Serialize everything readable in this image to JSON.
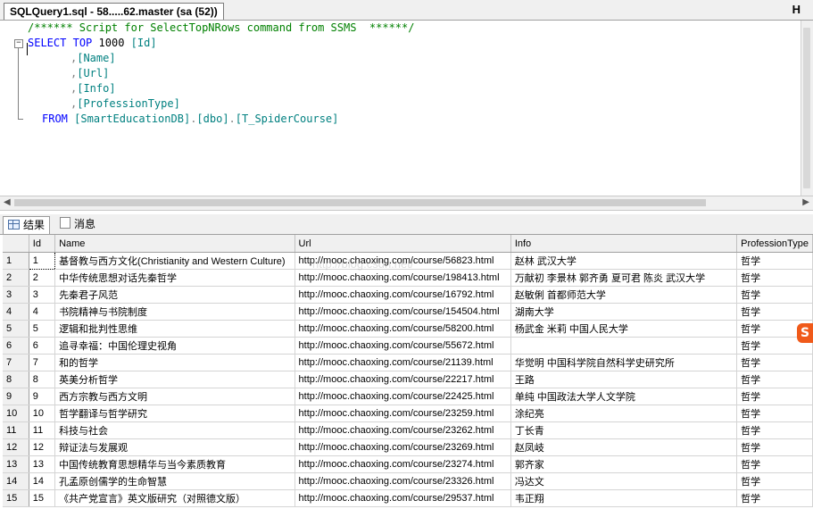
{
  "tab": {
    "title": "SQLQuery1.sql - 58.....62.master (sa (52))",
    "split": "H"
  },
  "editor": {
    "comment": "/****** Script for SelectTopNRows command from SSMS  ******/",
    "select_kw": "SELECT",
    "top_kw": "TOP",
    "top_n": "1000",
    "col1": "[Id]",
    "cols": [
      "[Name]",
      "[Url]",
      "[Info]",
      "[ProfessionType]"
    ],
    "from_kw": "FROM",
    "db": "[SmartEducationDB]",
    "schema": "[dbo]",
    "table": "[T_SpiderCourse]"
  },
  "result_tabs": {
    "results": "结果",
    "messages": "消息"
  },
  "grid": {
    "columns": [
      "Id",
      "Name",
      "Url",
      "Info",
      "ProfessionType"
    ],
    "rows": [
      [
        "1",
        "1",
        "基督教与西方文化(Christianity and Western Culture)",
        "http://mooc.chaoxing.com/course/56823.html",
        "赵林 武汉大学",
        "哲学"
      ],
      [
        "2",
        "2",
        "中华传统思想对话先秦哲学",
        "http://mooc.chaoxing.com/course/198413.html",
        "万献初 李景林 郭齐勇 夏可君 陈炎  武汉大学",
        "哲学"
      ],
      [
        "3",
        "3",
        "先秦君子风范",
        "http://mooc.chaoxing.com/course/16792.html",
        "赵敏俐 首都师范大学",
        "哲学"
      ],
      [
        "4",
        "4",
        "书院精神与书院制度",
        "http://mooc.chaoxing.com/course/154504.html",
        "湖南大学",
        "哲学"
      ],
      [
        "5",
        "5",
        "逻辑和批判性思维",
        "http://mooc.chaoxing.com/course/58200.html",
        "杨武金 米莉  中国人民大学",
        "哲学"
      ],
      [
        "6",
        "6",
        "追寻幸福：中国伦理史视角",
        "http://mooc.chaoxing.com/course/55672.html",
        "",
        "哲学"
      ],
      [
        "7",
        "7",
        "和的哲学",
        "http://mooc.chaoxing.com/course/21139.html",
        "华觉明 中国科学院自然科学史研究所",
        "哲学"
      ],
      [
        "8",
        "8",
        "英美分析哲学",
        "http://mooc.chaoxing.com/course/22217.html",
        "王路",
        "哲学"
      ],
      [
        "9",
        "9",
        "西方宗教与西方文明",
        "http://mooc.chaoxing.com/course/22425.html",
        "单纯 中国政法大学人文学院",
        "哲学"
      ],
      [
        "10",
        "10",
        "哲学翻译与哲学研究",
        "http://mooc.chaoxing.com/course/23259.html",
        "涂纪亮",
        "哲学"
      ],
      [
        "11",
        "11",
        "科技与社会",
        "http://mooc.chaoxing.com/course/23262.html",
        "丁长青",
        "哲学"
      ],
      [
        "12",
        "12",
        "辩证法与发展观",
        "http://mooc.chaoxing.com/course/23269.html",
        "赵凤岐",
        "哲学"
      ],
      [
        "13",
        "13",
        "中国传统教育思想精华与当今素质教育",
        "http://mooc.chaoxing.com/course/23274.html",
        "郭齐家",
        "哲学"
      ],
      [
        "14",
        "14",
        "孔孟原创儒学的生命智慧",
        "http://mooc.chaoxing.com/course/23326.html",
        "冯达文",
        "哲学"
      ],
      [
        "15",
        "15",
        "《共产党宣言》英文版研究（对照德文版）",
        "http://mooc.chaoxing.com/course/29537.html",
        "韦正翔",
        "哲学"
      ]
    ]
  },
  "watermark": "http://blog.csdn.net/",
  "badge": "S"
}
